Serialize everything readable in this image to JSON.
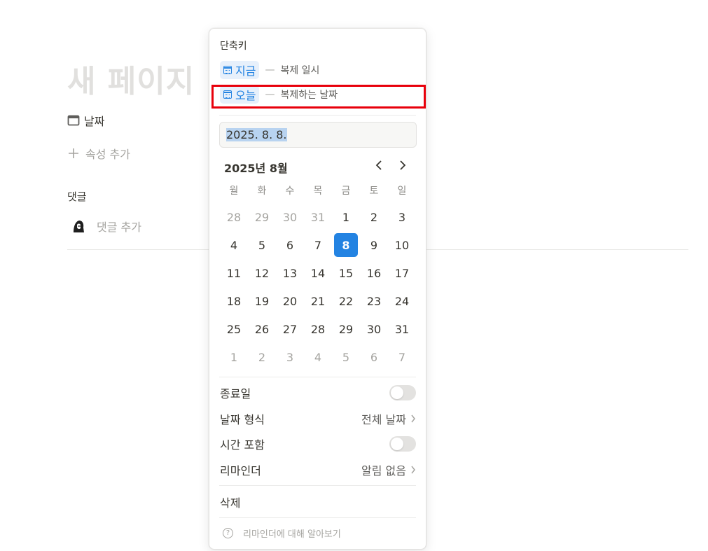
{
  "page": {
    "title": "새 페이지",
    "property_label": "날짜",
    "add_property": "속성 추가",
    "comments_label": "댓글",
    "add_comment": "댓글 추가"
  },
  "popover": {
    "shortcut_header": "단축키",
    "shortcuts": [
      {
        "label": "지금",
        "desc": "복제 일시"
      },
      {
        "label": "오늘",
        "desc": "복제하는 날짜"
      }
    ],
    "date_input_value": "2025. 8. 8.",
    "calendar": {
      "month_title": "2025년 8월",
      "weekdays": [
        "월",
        "화",
        "수",
        "목",
        "금",
        "토",
        "일"
      ],
      "weeks": [
        [
          "28",
          "29",
          "30",
          "31",
          "1",
          "2",
          "3"
        ],
        [
          "4",
          "5",
          "6",
          "7",
          "8",
          "9",
          "10"
        ],
        [
          "11",
          "12",
          "13",
          "14",
          "15",
          "16",
          "17"
        ],
        [
          "18",
          "19",
          "20",
          "21",
          "22",
          "23",
          "24"
        ],
        [
          "25",
          "26",
          "27",
          "28",
          "29",
          "30",
          "31"
        ],
        [
          "1",
          "2",
          "3",
          "4",
          "5",
          "6",
          "7"
        ]
      ],
      "selected_day": "8"
    },
    "options": {
      "end_date": {
        "label": "종료일",
        "enabled": false
      },
      "date_format": {
        "label": "날짜 형식",
        "value": "전체 날짜"
      },
      "include_time": {
        "label": "시간 포함",
        "enabled": false
      },
      "reminder": {
        "label": "리마인더",
        "value": "알림 없음"
      }
    },
    "delete_label": "삭제",
    "help_text": "리마인더에 대해 알아보기"
  },
  "colors": {
    "accent": "#2383e2",
    "highlight": "#e8000b",
    "muted_text": "#a5a4a0"
  }
}
